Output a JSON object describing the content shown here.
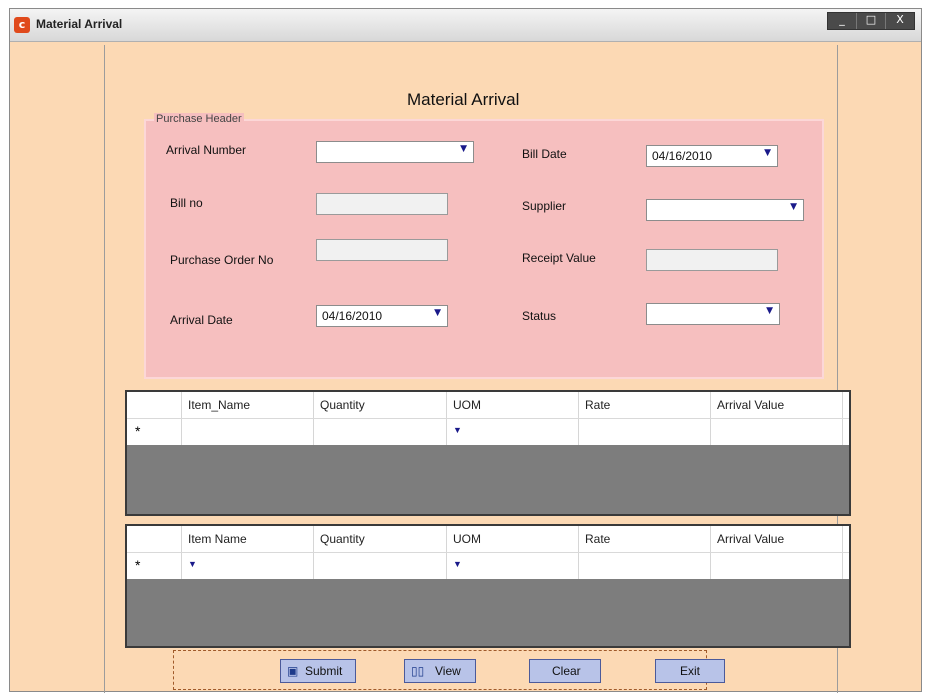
{
  "window": {
    "title": "Material Arrival",
    "controls": [
      "_",
      "□",
      "X"
    ]
  },
  "form": {
    "title": "Material Arrival",
    "group_label": "Purchase Header",
    "fields": {
      "arrival_number": {
        "label": "Arrival Number",
        "value": ""
      },
      "bill_no": {
        "label": "Bill no",
        "value": ""
      },
      "purchase_order_no": {
        "label": "Purchase Order No",
        "value": ""
      },
      "arrival_date": {
        "label": "Arrival Date",
        "value": "04/16/2010"
      },
      "bill_date": {
        "label": "Bill Date",
        "value": "04/16/2010"
      },
      "supplier": {
        "label": "Supplier",
        "value": ""
      },
      "receipt_value": {
        "label": "Receipt Value",
        "value": ""
      },
      "status": {
        "label": "Status",
        "value": ""
      }
    }
  },
  "grid1": {
    "columns": [
      "Item_Name",
      "Quantity",
      "UOM",
      "Rate",
      "Arrival Value"
    ],
    "new_row_marker": "*"
  },
  "grid2": {
    "columns": [
      "Item Name",
      "Quantity",
      "UOM",
      "Rate",
      "Arrival Value"
    ],
    "new_row_marker": "*"
  },
  "buttons": {
    "submit": "Submit",
    "view": "View",
    "clear": "Clear",
    "exit": "Exit"
  },
  "icons": {
    "app": "app-icon",
    "dropdown": "chevron-down-icon",
    "save": "save-icon",
    "view": "book-icon"
  }
}
